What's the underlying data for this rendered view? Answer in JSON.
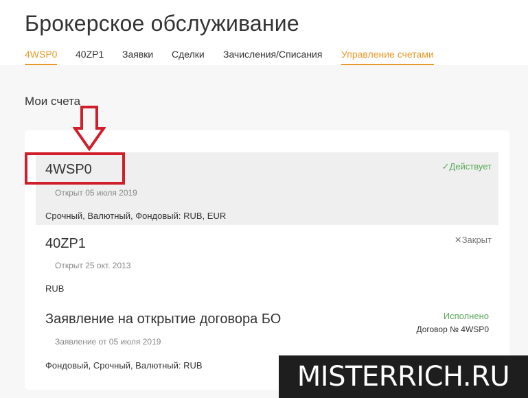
{
  "header": {
    "title": "Брокерское обслуживание",
    "tabs": [
      {
        "label": "4WSP0",
        "active": true
      },
      {
        "label": "40ZP1",
        "active": false
      },
      {
        "label": "Заявки",
        "active": false
      },
      {
        "label": "Сделки",
        "active": false
      },
      {
        "label": "Зачисления/Списания",
        "active": false
      },
      {
        "label": "Управление счетами",
        "active": true
      }
    ]
  },
  "main": {
    "section_title": "Мои счета",
    "accounts": [
      {
        "name": "4WSP0",
        "date": "Открыт 05 июля 2019",
        "markets": "Срочный, Валютный, Фондовый: RUB, EUR",
        "status": "Действует",
        "status_icon": "check-icon"
      },
      {
        "name": "40ZP1",
        "date": "Открыт 25 окт. 2013",
        "markets": "RUB",
        "status": "Закрыт",
        "status_icon": "close-icon"
      },
      {
        "name": "Заявление на открытие договора БО",
        "date": "Заявление от 05 июля 2019",
        "markets": "Фондовый, Срочный, Валютный: RUB",
        "status": "Исполнено",
        "contract": "Договор № 4WSP0"
      }
    ]
  },
  "watermark": "MISTERRICH.RU",
  "colors": {
    "accent": "#e89a2b",
    "status_active": "#5aa85a",
    "status_closed": "#777777",
    "annotation": "#d01e2a",
    "selected_row": "#efefef",
    "background": "#f7f7f7"
  }
}
